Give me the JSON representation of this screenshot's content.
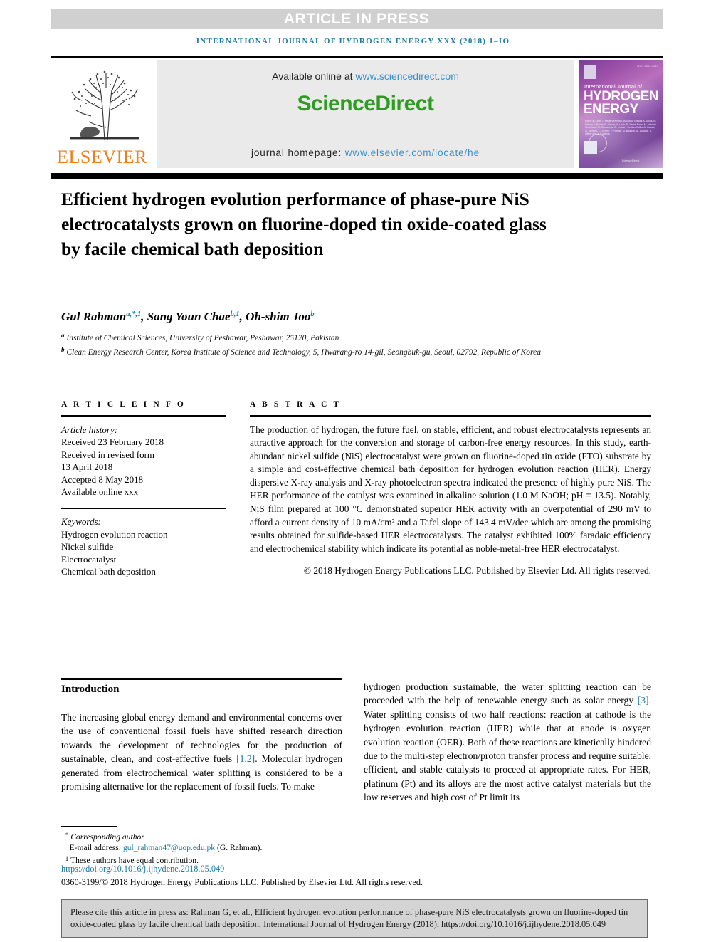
{
  "banner": {
    "article_in_press": "ARTICLE IN PRESS",
    "running_head": "INTERNATIONAL JOURNAL OF HYDROGEN ENERGY XXX (2018) 1–IO"
  },
  "masthead": {
    "publisher": "ELSEVIER",
    "available_prefix": "Available online at ",
    "available_url": "www.sciencedirect.com",
    "sciencedirect_logo": "ScienceDirect",
    "homepage_prefix": "journal homepage: ",
    "homepage_url": "www.elsevier.com/locate/he",
    "cover": {
      "issn": "ISSN 0360-3199",
      "line1": "International Journal of",
      "word1": "HYDROGEN",
      "word2": "ENERGY",
      "editors": "Editor-in-Chief   T. Nejat Veziroglu\nAssociate Editors   A. Dicks, M.\nEditors   F. Barbir, E. Dincer, A. Lech,\nR. Frank Ross,\nM. Antonio Mehlmann\nM. Grosvenor, D. Lincoln,\nSection Editor   A. Ozturk, G. Suppes, C. Verbal,\nF. Pathak, M. Bogdan, M. Aldgate,\nJ. Oliver and Y. Kodama",
      "footer": "Hydrogen Energy Publications, LLC",
      "imprint": "ScienceDirect"
    }
  },
  "article": {
    "title": "Efficient hydrogen evolution performance of phase-pure NiS electrocatalysts grown on fluorine-doped tin oxide-coated glass by facile chemical bath deposition",
    "authors": [
      {
        "name": "Gul Rahman",
        "marks": "a,*,1"
      },
      {
        "name": "Sang Youn Chae",
        "marks": "b,1"
      },
      {
        "name": "Oh-shim Joo",
        "marks": "b"
      }
    ],
    "affiliations": [
      {
        "mark": "a",
        "text": "Institute of Chemical Sciences, University of Peshawar, Peshawar, 25120, Pakistan"
      },
      {
        "mark": "b",
        "text": "Clean Energy Research Center, Korea Institute of Science and Technology, 5, Hwarang-ro 14-gil, Seongbuk-gu, Seoul, 02792, Republic of Korea"
      }
    ]
  },
  "article_info": {
    "heading": "A R T I C L E   I N F O",
    "history_label": "Article history:",
    "history": [
      "Received 23 February 2018",
      "Received in revised form",
      "13 April 2018",
      "Accepted 8 May 2018",
      "Available online xxx"
    ],
    "keywords_label": "Keywords:",
    "keywords": [
      "Hydrogen evolution reaction",
      "Nickel sulfide",
      "Electrocatalyst",
      "Chemical bath deposition"
    ]
  },
  "abstract": {
    "heading": "A B S T R A C T",
    "text": "The production of hydrogen, the future fuel, on stable, efficient, and robust electrocatalysts represents an attractive approach for the conversion and storage of carbon-free energy resources. In this study, earth-abundant nickel sulfide (NiS) electrocatalyst were grown on fluorine-doped tin oxide (FTO) substrate by a simple and cost-effective chemical bath deposition for hydrogen evolution reaction (HER). Energy dispersive X-ray analysis and X-ray photoelectron spectra indicated the presence of highly pure NiS. The HER performance of the catalyst was examined in alkaline solution (1.0 M NaOH; pH = 13.5). Notably, NiS film prepared at 100 °C demonstrated superior HER activity with an overpotential of 290 mV to afford a current density of 10 mA/cm² and a Tafel slope of 143.4 mV/dec which are among the promising results obtained for sulfide-based HER electrocatalysts. The catalyst exhibited 100% faradaic efficiency and electrochemical stability which indicate its potential as noble-metal-free HER electrocatalyst.",
    "copyright": "© 2018 Hydrogen Energy Publications LLC. Published by Elsevier Ltd. All rights reserved."
  },
  "introduction": {
    "heading": "Introduction",
    "col_left_part1": "The increasing global energy demand and environmental concerns over the use of conventional fossil fuels have shifted research direction towards the development of technologies for the production of sustainable, clean, and cost-effective fuels ",
    "ref1": "[1,2]",
    "col_left_part2": ". Molecular hydrogen generated from electrochemical water splitting is considered to be a promising alternative for the replacement of fossil fuels. To make",
    "col_right_part1": "hydrogen production sustainable, the water splitting reaction can be proceeded with the help of renewable energy such as solar energy ",
    "ref2": "[3]",
    "col_right_part2": ". Water splitting consists of two half reactions: reaction at cathode is the hydrogen evolution reaction (HER) while that at anode is oxygen evolution reaction (OER). Both of these reactions are kinetically hindered due to the multi-step electron/proton transfer process and require suitable, efficient, and stable catalysts to proceed at appropriate rates. For HER, platinum (Pt) and its alloys are the most active catalyst materials but the low reserves and high cost of Pt limit its"
  },
  "footnotes": {
    "corresponding_mark": "*",
    "corresponding_label": "Corresponding author.",
    "email_label": "E-mail address: ",
    "email": "gul_rahman47@uop.edu.pk",
    "email_suffix": " (G. Rahman).",
    "equal_mark": "1",
    "equal_text": "These authors have equal contribution.",
    "doi": "https://doi.org/10.1016/j.ijhydene.2018.05.049",
    "issn_line": "0360-3199/© 2018 Hydrogen Energy Publications LLC. Published by Elsevier Ltd. All rights reserved."
  },
  "cite_box": {
    "text": "Please cite this article in press as: Rahman G, et al., Efficient hydrogen evolution performance of phase-pure NiS electrocatalysts grown on fluorine-doped tin oxide-coated glass by facile chemical bath deposition, International Journal of Hydrogen Energy (2018), https://doi.org/10.1016/j.ijhydene.2018.05.049"
  },
  "colors": {
    "link": "#1b7aa6",
    "elsevier_orange": "#ef7d1a",
    "sciencedirect_green": "#2f9b22",
    "banner_gray": "#d0d0d0",
    "panel_gray": "#eaeaea",
    "cite_box_gray": "#d4d4d4"
  }
}
